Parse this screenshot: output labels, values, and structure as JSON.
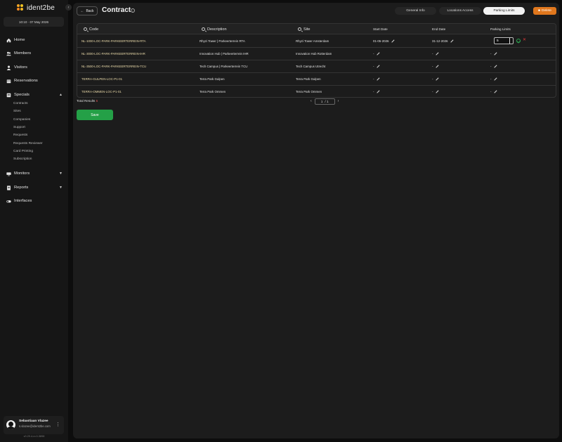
{
  "app": {
    "logo_text": "ident2be",
    "datetime": "10:10 · 07 May 2026",
    "version": "v0.29.4-rc.0-3898"
  },
  "sidebar": {
    "items": [
      {
        "label": "Home",
        "icon": "home-icon"
      },
      {
        "label": "Members",
        "icon": "users-icon"
      },
      {
        "label": "Visitors",
        "icon": "visitor-icon"
      },
      {
        "label": "Reservations",
        "icon": "calendar-icon"
      },
      {
        "label": "Specials",
        "icon": "folder-icon",
        "expanded": true
      },
      {
        "label": "Monitors",
        "icon": "monitor-icon"
      },
      {
        "label": "Reports",
        "icon": "report-icon"
      },
      {
        "label": "Interfaces",
        "icon": "toggle-icon"
      }
    ],
    "specials_sub": [
      "Contracts",
      "Sites",
      "Companies",
      "Support",
      "Requests",
      "Requests Reviewer",
      "Card Printing",
      "Subscription"
    ]
  },
  "user": {
    "name": "Sebastiaan Vlazee",
    "email": "s.vlazee@ident2be.com"
  },
  "header": {
    "back_label": "Back",
    "title": "Contract",
    "tabs": [
      "General Info",
      "Locations Access",
      "Parking Limits"
    ],
    "active_tab": "Parking Limits",
    "delete_label": "Delete"
  },
  "table": {
    "columns": {
      "code": "Code",
      "description": "Description",
      "site": "Site",
      "start_date": "Start Date",
      "end_date": "End Date",
      "parking_limits": "Parking Limits"
    },
    "rows": [
      {
        "code": "NL-1000-LOC-PARK-PARKEERTERREIN-RTA",
        "description": "Rhyzi Tower | Parkeerterrein RTA",
        "site": "Rhyzi Tower Amsterdam",
        "start": "01-05-2026",
        "end": "31-12-2026",
        "limit": "5"
      },
      {
        "code": "NL-3000-LOC-PARK-PARKEERTERREIN-IHR",
        "description": "Innovation Hub | Parkeerterrein IHR",
        "site": "Innovation Hub Rotterdam",
        "start": "-",
        "end": "-",
        "limit": "-"
      },
      {
        "code": "NL-3500-LOC-PARK-PARKEERTERREIN-TCU",
        "description": "Tech Campus | Parkeerterrein TCU",
        "site": "Tech Campus Utrecht",
        "start": "-",
        "end": "-",
        "limit": "-"
      },
      {
        "code": "TERRA-GULPEN-LOC-P1-01",
        "description": "Terra Park Gulpen",
        "site": "Terra Park Gulpen",
        "start": "-",
        "end": "-",
        "limit": "-"
      },
      {
        "code": "TERRA-OMMEN-LOC-P1-01",
        "description": "Terra Park Ommen",
        "site": "Terra Park Ommen",
        "start": "-",
        "end": "-",
        "limit": "-"
      }
    ],
    "editing_value": "5"
  },
  "footer": {
    "total_label": "Total Results",
    "total_count": "5",
    "page_current": "1",
    "page_total": "/ 1",
    "save_label": "Save"
  },
  "colors": {
    "accent_orange": "#e0771d",
    "save_green": "#24a047",
    "code_text": "#e8d8a8"
  }
}
